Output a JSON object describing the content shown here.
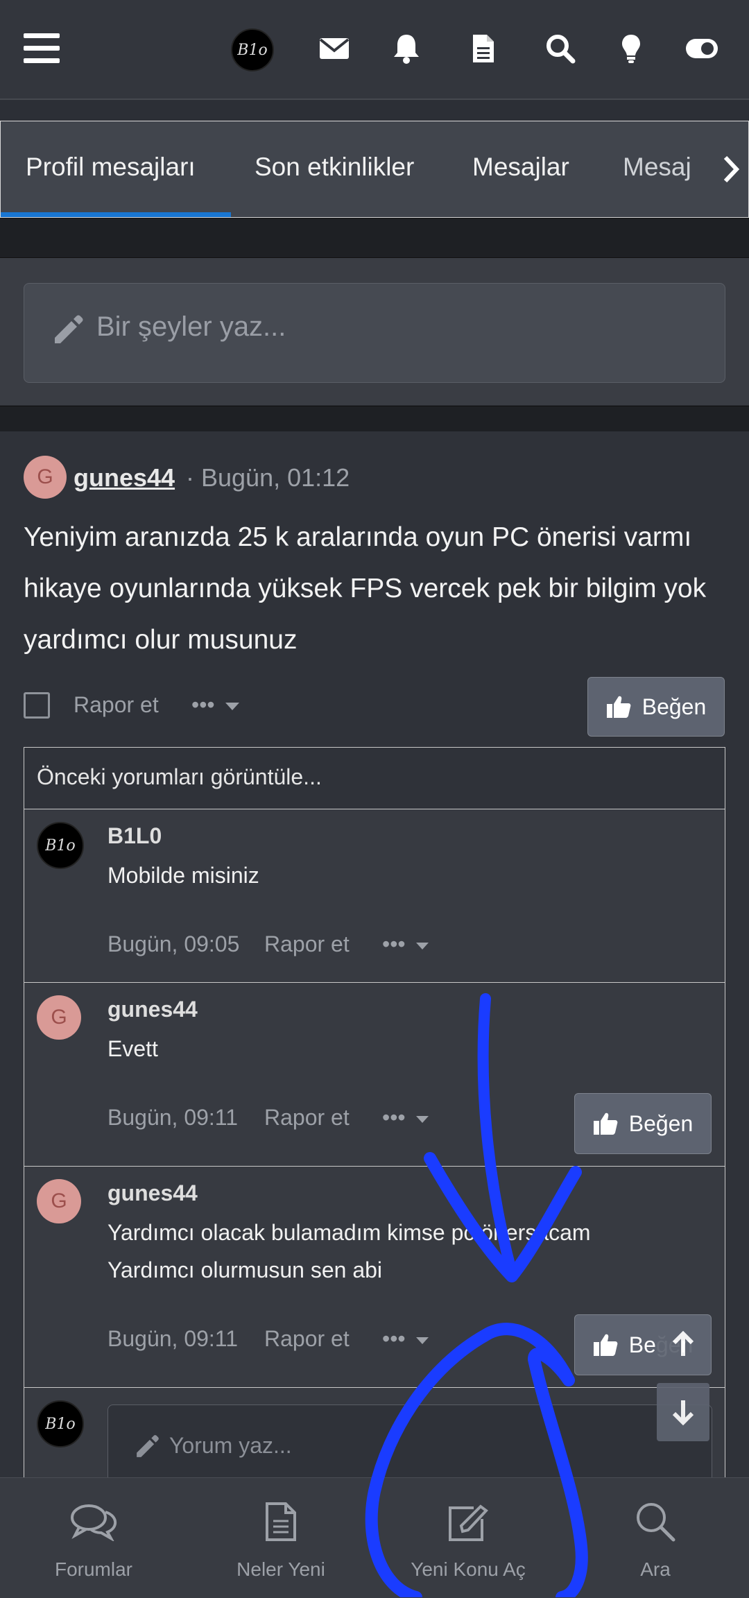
{
  "tabs": [
    "Profil mesajları",
    "Son etkinlikler",
    "Mesajlar",
    "Mesaj"
  ],
  "composer": {
    "placeholder": "Bir şeyler yaz..."
  },
  "post": {
    "avatar_letter": "G",
    "username": "gunes44",
    "meta": "· Bugün, 01:12",
    "text": "Yeniyim aranızda 25 k aralarında oyun PC önerisi varmı hikaye oyunlarında yüksek FPS vercek pek bir bilgim yok yardımcı olur musunuz",
    "report_label": "Rapor et",
    "more_label": "•••",
    "like_label": "Beğen"
  },
  "comments": {
    "previous_label": "Önceki yorumları görüntüle...",
    "logo_text": "B1o",
    "items": [
      {
        "author": "B1L0",
        "text": "Mobilde misiniz",
        "time": "Bugün, 09:05",
        "report": "Rapor et",
        "more": "•••"
      },
      {
        "author": "gunes44",
        "avatar_letter": "G",
        "text": "Evett",
        "time": "Bugün, 09:11",
        "report": "Rapor et",
        "more": "•••",
        "like": "Beğen"
      },
      {
        "author": "gunes44",
        "avatar_letter": "G",
        "text_line1": "Yardımcı olacak bulamadım kimse pc önersacam",
        "text_line2": "Yardımcı olurmusun sen abi",
        "time": "Bugün, 09:11",
        "report": "Rapor et",
        "more": "•••",
        "like": "Beğen"
      }
    ],
    "reply_placeholder": "Yorum yaz..."
  },
  "bottom_nav": [
    {
      "label": "Forumlar",
      "icon": "comments-icon"
    },
    {
      "label": "Neler Yeni",
      "icon": "document-icon"
    },
    {
      "label": "Yeni Konu Aç",
      "icon": "edit-icon"
    },
    {
      "label": "Ara",
      "icon": "search-icon"
    }
  ],
  "colors": {
    "accent": "#1976d2",
    "annotation": "#1a3cff",
    "avatar": "#d99a96"
  }
}
